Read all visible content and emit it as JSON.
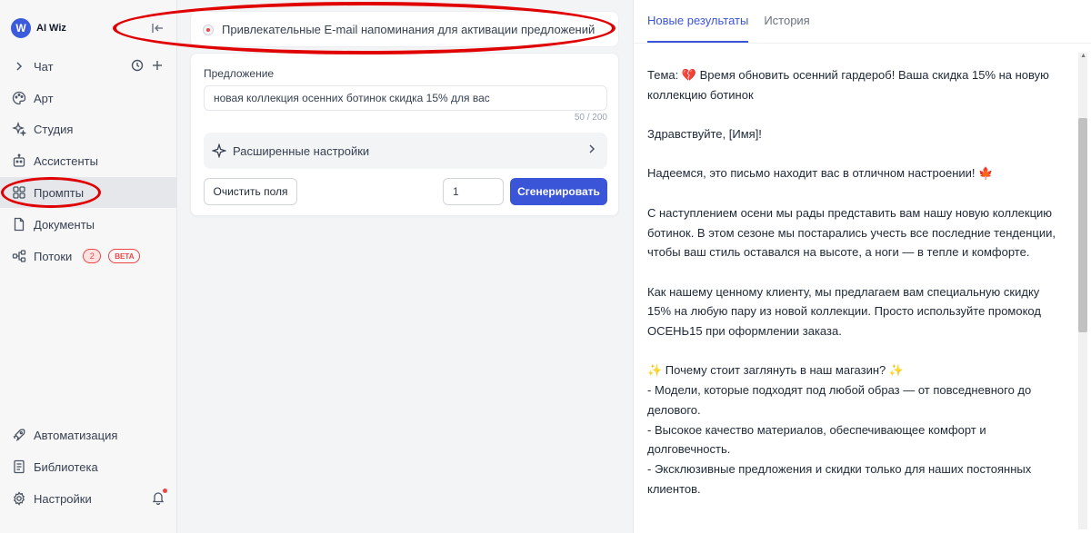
{
  "brand": {
    "name": "AI Wiz"
  },
  "sidebar": {
    "items": [
      {
        "label": "Чат",
        "icon": "chevron-right-icon"
      },
      {
        "label": "Арт",
        "icon": "palette-icon"
      },
      {
        "label": "Студия",
        "icon": "sparkles-icon"
      },
      {
        "label": "Ассистенты",
        "icon": "robot-icon"
      },
      {
        "label": "Промпты",
        "icon": "grid-icon",
        "active": true
      },
      {
        "label": "Документы",
        "icon": "document-icon"
      },
      {
        "label": "Потоки",
        "icon": "flow-icon",
        "badge": "2",
        "tag": "BETA"
      }
    ],
    "bottom": [
      {
        "label": "Автоматизация",
        "icon": "rocket-icon"
      },
      {
        "label": "Библиотека",
        "icon": "book-icon"
      },
      {
        "label": "Настройки",
        "icon": "gear-icon"
      }
    ]
  },
  "prompt": {
    "title": "Привлекательные E-mail напоминания для активации предложений"
  },
  "form": {
    "label": "Предложение",
    "value": "новая коллекция осенних ботинок скидка 15% для вас",
    "char_count": "50 / 200",
    "advanced_label": "Расширенные настройки",
    "clear_label": "Очистить поля",
    "quantity": "1",
    "generate_label": "Сгенерировать"
  },
  "results": {
    "tabs": [
      "Новые результаты",
      "История"
    ],
    "paragraphs": [
      [
        "Тема: 💔 Время обновить осенний гардероб! Ваша скидка 15% на новую коллекцию ботинок"
      ],
      [
        "Здравствуйте, [Имя]!"
      ],
      [
        "Надеемся, это письмо находит вас в отличном настроении! 🍁"
      ],
      [
        "С наступлением осени мы рады представить вам нашу новую коллекцию ботинок. В этом сезоне мы постарались учесть все последние тенденции, чтобы ваш стиль оставался на высоте, а ноги — в тепле и комфорте."
      ],
      [
        "Как нашему ценному клиенту, мы предлагаем вам специальную скидку 15% на любую пару из новой коллекции. Просто используйте промокод ОСЕНЬ15 при оформлении заказа."
      ],
      [
        "✨ Почему стоит заглянуть в наш магазин? ✨",
        "- Модели, которые подходят под любой образ — от повседневного до делового.",
        "- Высокое качество материалов, обеспечивающее комфорт и долговечность.",
        "- Эксклюзивные предложения и скидки только для наших постоянных клиентов."
      ]
    ]
  }
}
